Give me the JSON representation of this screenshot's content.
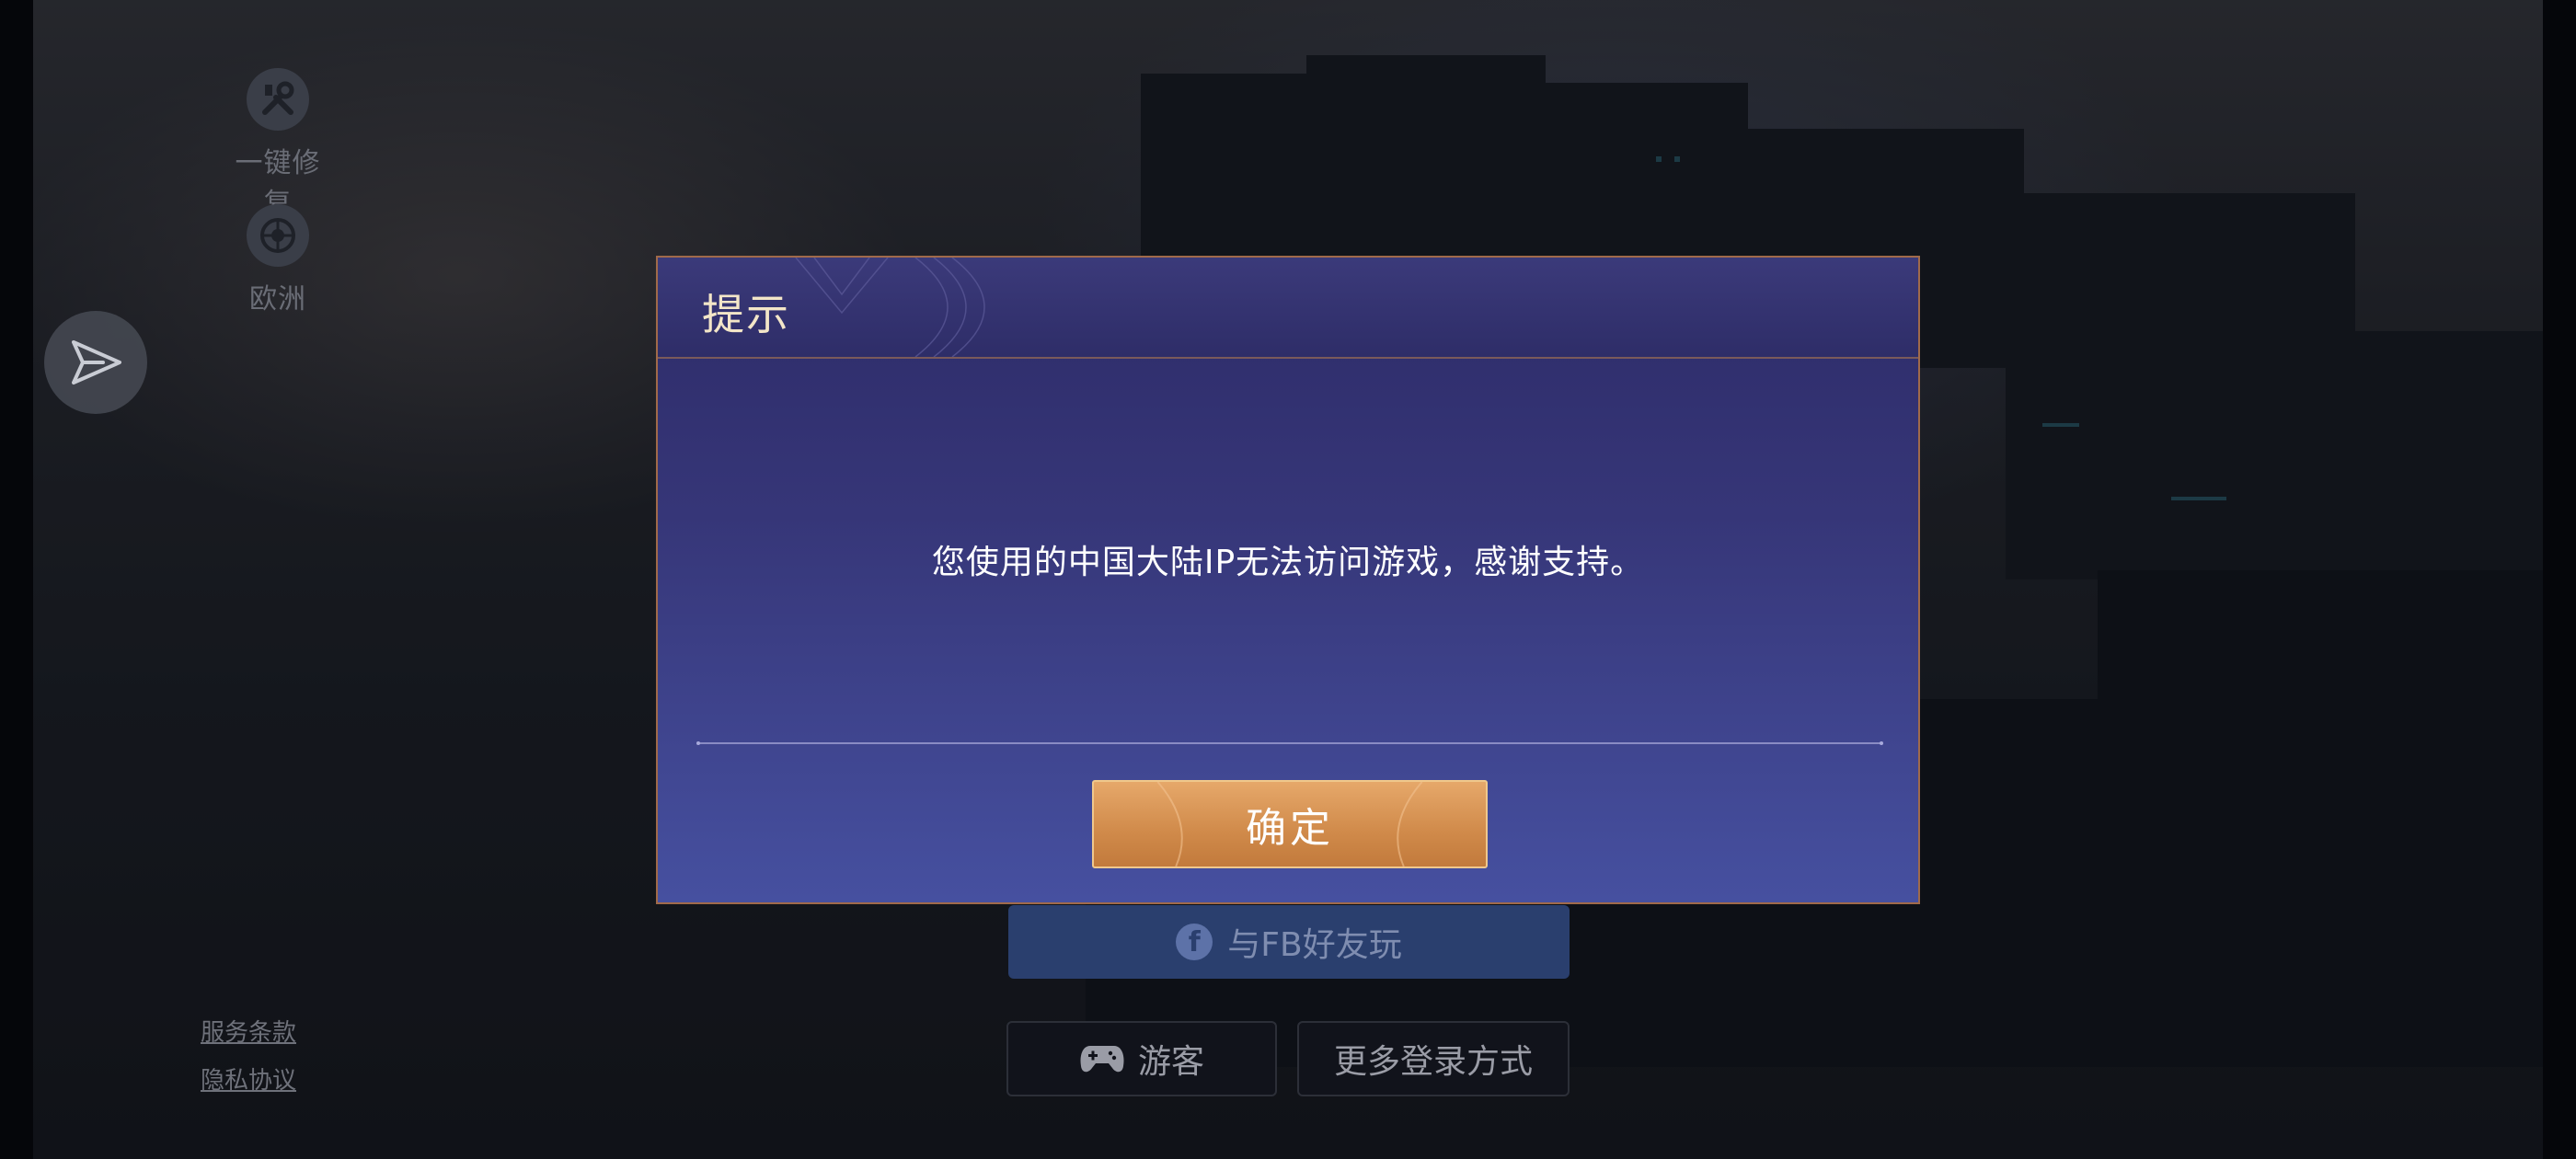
{
  "side_tools": [
    {
      "label": "一键修复",
      "icon": "wrench-screwdriver-icon"
    },
    {
      "label": "欧洲",
      "icon": "globe-server-icon"
    }
  ],
  "send_icon": "paper-plane-icon",
  "legal_links": {
    "terms": "服务条款",
    "privacy": "隐私协议"
  },
  "login": {
    "fb_button": "与FB好友玩",
    "fb_icon": "facebook-icon",
    "guest_button": "游客",
    "guest_icon": "gamepad-icon",
    "more_button": "更多登录方式"
  },
  "dialog": {
    "title": "提示",
    "message": "您使用的中国大陆IP无法访问游戏，感谢支持。",
    "confirm": "确定"
  },
  "colors": {
    "dialog_top": "#2d2b68",
    "dialog_bottom": "#4650a0",
    "confirm_button": "#d08a4a",
    "title_text": "#f3e6c8"
  }
}
